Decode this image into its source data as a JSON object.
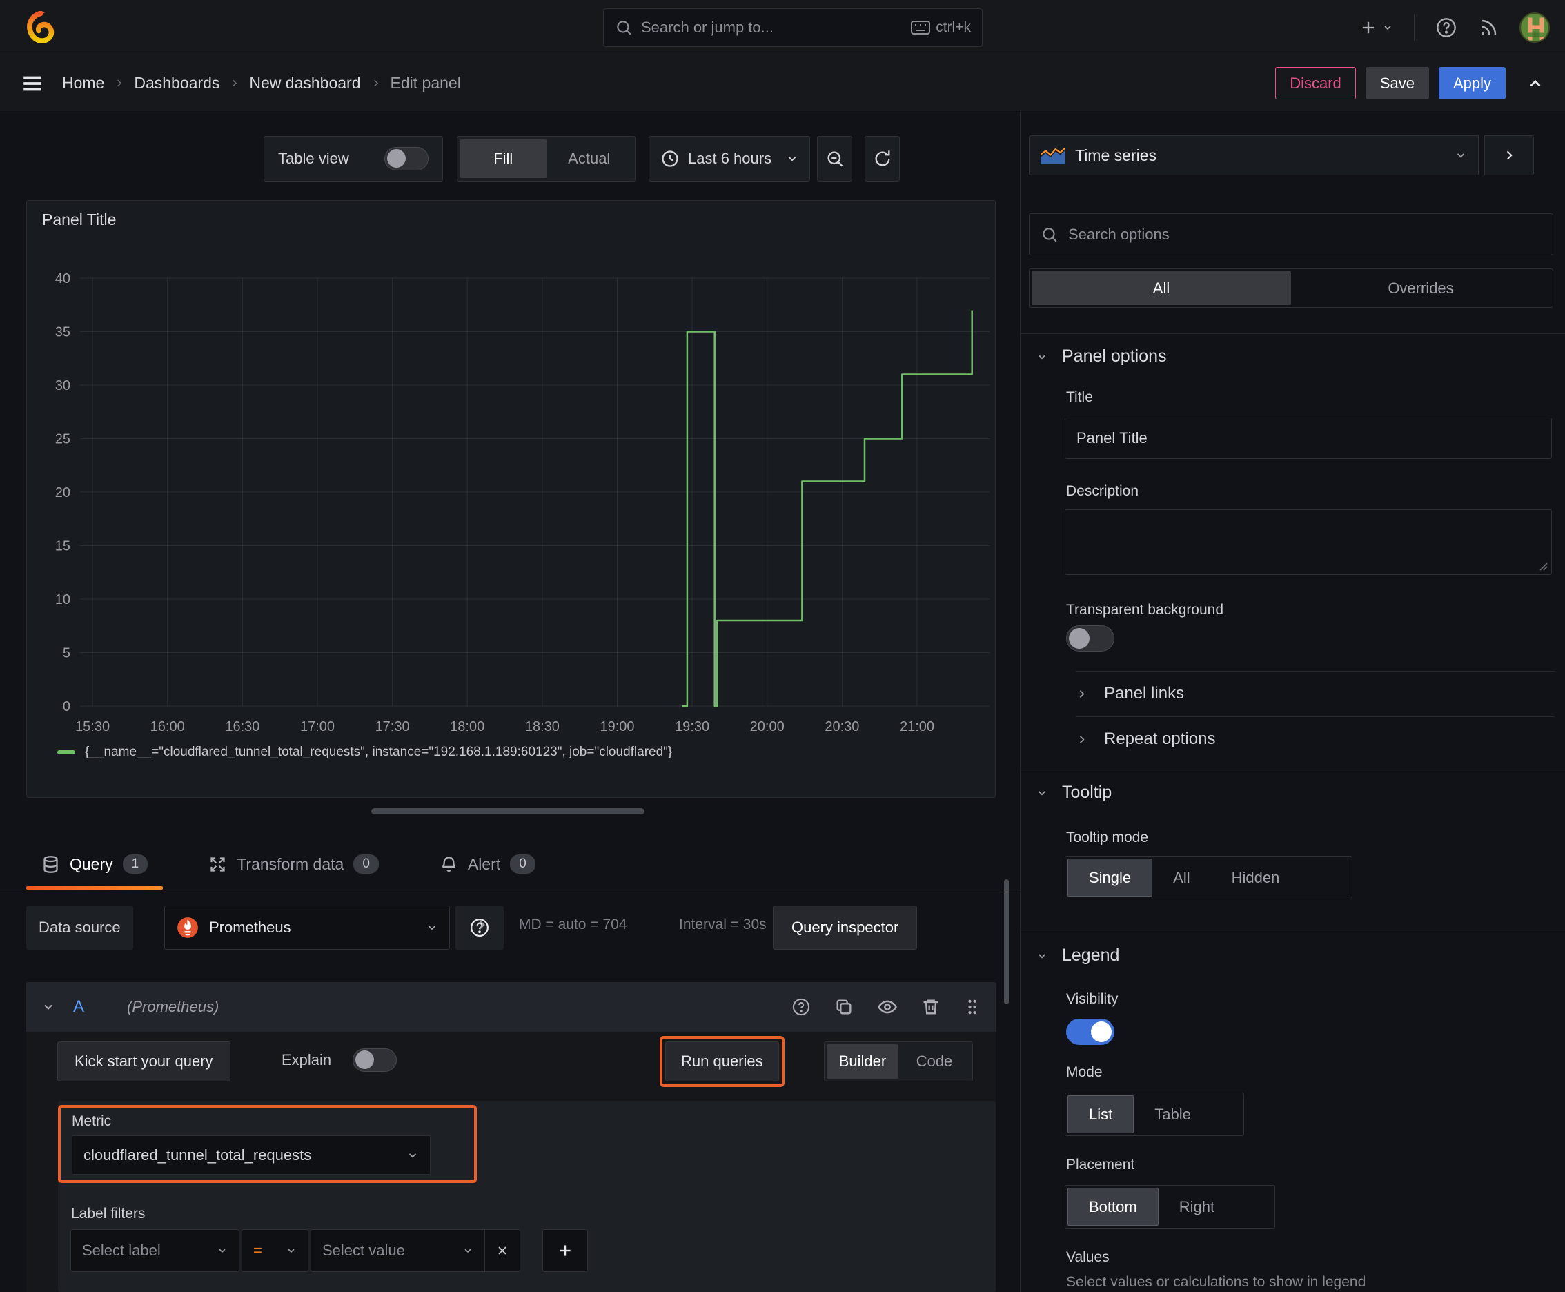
{
  "colors": {
    "series_green": "#73bf69",
    "highlight_orange": "#e8612c",
    "primary_blue": "#3d71d9",
    "discard_pink": "#e5548c"
  },
  "topbar": {
    "search_placeholder": "Search or jump to...",
    "shortcut": "ctrl+k"
  },
  "breadcrumb": {
    "items": [
      "Home",
      "Dashboards",
      "New dashboard",
      "Edit panel"
    ]
  },
  "actions": {
    "discard": "Discard",
    "save": "Save",
    "apply": "Apply"
  },
  "viz_toolbar": {
    "table_view_label": "Table view",
    "fill_label": "Fill",
    "actual_label": "Actual",
    "time_range_label": "Last 6 hours"
  },
  "panel": {
    "title": "Panel Title"
  },
  "chart_data": {
    "type": "line",
    "render": "step-after",
    "title": "Panel Title",
    "xlabel": "",
    "ylabel": "",
    "ylim": [
      0,
      40
    ],
    "yticks": [
      0,
      5,
      10,
      15,
      20,
      25,
      30,
      35,
      40
    ],
    "x_domain": [
      "15:25",
      "21:29"
    ],
    "xticks": [
      "15:30",
      "16:00",
      "16:30",
      "17:00",
      "17:30",
      "18:00",
      "18:30",
      "19:00",
      "19:30",
      "20:00",
      "20:30",
      "21:00"
    ],
    "grid": true,
    "legend_position": "bottom",
    "series": [
      {
        "label": "{__name__=\"cloudflared_tunnel_total_requests\", instance=\"192.168.1.189:60123\", job=\"cloudflared\"}",
        "color": "#73bf69",
        "points": [
          {
            "time": "19:26",
            "value": 0
          },
          {
            "time": "19:28",
            "value": 35
          },
          {
            "time": "19:39",
            "value": 0
          },
          {
            "time": "19:40",
            "value": 8
          },
          {
            "time": "20:14",
            "value": 21
          },
          {
            "time": "20:39",
            "value": 25
          },
          {
            "time": "20:54",
            "value": 31
          },
          {
            "time": "21:22",
            "value": 37
          }
        ]
      }
    ]
  },
  "query_tabs": {
    "query_label": "Query",
    "query_count": "1",
    "transform_label": "Transform data",
    "transform_count": "0",
    "alert_label": "Alert",
    "alert_count": "0"
  },
  "datasource_row": {
    "label": "Data source",
    "datasource": "Prometheus",
    "md_stat": "MD = auto = 704",
    "interval_stat": "Interval = 30s",
    "query_inspector_label": "Query inspector"
  },
  "query_editor": {
    "ref_id": "A",
    "datasource_hint": "(Prometheus)",
    "kick_start_label": "Kick start your query",
    "explain_label": "Explain",
    "run_queries_label": "Run queries",
    "builder_label": "Builder",
    "code_label": "Code",
    "metric_label": "Metric",
    "metric_value": "cloudflared_tunnel_total_requests",
    "label_filters_label": "Label filters",
    "select_label_placeholder": "Select label",
    "operator": "=",
    "select_value_placeholder": "Select value"
  },
  "options_sidebar": {
    "visualization": "Time series",
    "search_placeholder": "Search options",
    "tabs": {
      "all": "All",
      "overrides": "Overrides"
    },
    "panel_options": {
      "header": "Panel options",
      "title_label": "Title",
      "title_value": "Panel Title",
      "description_label": "Description",
      "transparent_label": "Transparent background"
    },
    "collapsed_sections": {
      "panel_links": "Panel links",
      "repeat_options": "Repeat options"
    },
    "tooltip": {
      "header": "Tooltip",
      "mode_label": "Tooltip mode",
      "options": [
        "Single",
        "All",
        "Hidden"
      ],
      "selected": "Single"
    },
    "legend": {
      "header": "Legend",
      "visibility_label": "Visibility",
      "mode_label": "Mode",
      "mode_options": [
        "List",
        "Table"
      ],
      "mode_selected": "List",
      "placement_label": "Placement",
      "placement_options": [
        "Bottom",
        "Right"
      ],
      "placement_selected": "Bottom",
      "values_label": "Values",
      "values_hint": "Select values or calculations to show in legend"
    }
  }
}
